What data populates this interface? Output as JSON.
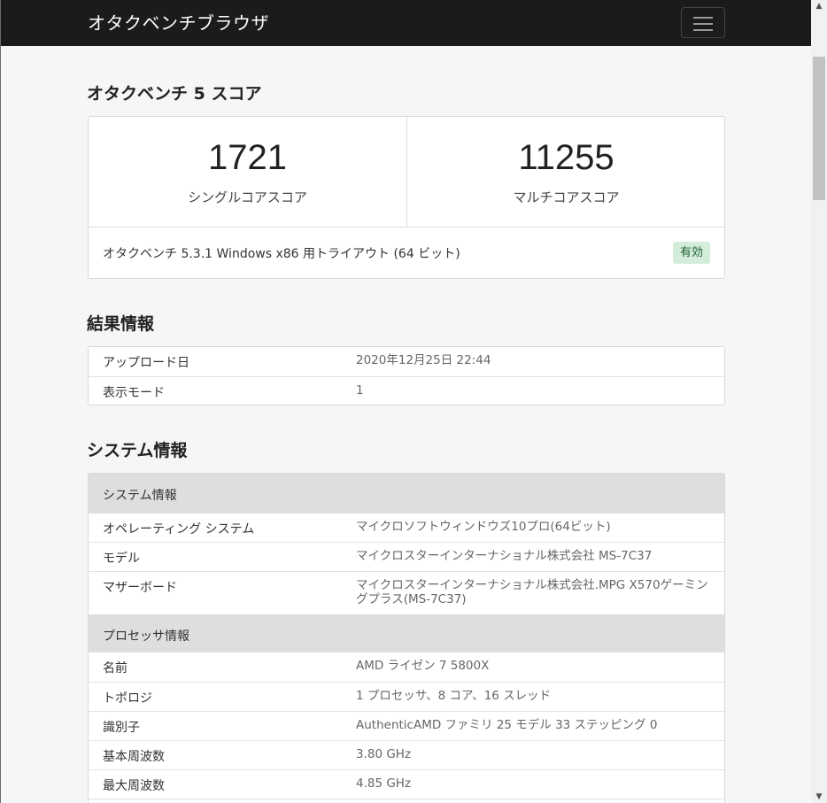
{
  "nav": {
    "brand": "オタクベンチブラウザ",
    "menu_icon": "hamburger-icon"
  },
  "score": {
    "title": "オタクベンチ 5 スコア",
    "single_value": "1721",
    "single_label": "シングルコアスコア",
    "multi_value": "11255",
    "multi_label": "マルチコアスコア",
    "version": "オタクベンチ 5.3.1 Windows x86 用トライアウト (64 ビット)",
    "badge": "有効"
  },
  "result": {
    "title": "結果情報",
    "rows": [
      {
        "key": "アップロード日",
        "value": "2020年12月25日 22:44"
      },
      {
        "key": "表示モード",
        "value": "1"
      }
    ]
  },
  "system": {
    "title": "システム情報",
    "groups": [
      {
        "header": "システム情報",
        "rows": [
          {
            "key": "オペレーティング システム",
            "value": "マイクロソフトウィンドウズ10プロ(64ビット)"
          },
          {
            "key": "モデル",
            "value": "マイクロスターインターナショナル株式会社 MS-7C37"
          },
          {
            "key": "マザーボード",
            "value": "マイクロスターインターナショナル株式会社.MPG X570ゲーミングプラス(MS-7C37)"
          }
        ]
      },
      {
        "header": "プロセッサ情報",
        "rows": [
          {
            "key": "名前",
            "value": "AMD ライゼン 7 5800X"
          },
          {
            "key": "トポロジ",
            "value": "1 プロセッサ、8 コア、16 スレッド"
          },
          {
            "key": "識別子",
            "value": "AuthenticAMD ファミリ 25 モデル 33 ステッピング 0"
          },
          {
            "key": "基本周波数",
            "value": "3.80 GHz"
          },
          {
            "key": "最大周波数",
            "value": "4.85 GHz"
          }
        ]
      }
    ]
  }
}
